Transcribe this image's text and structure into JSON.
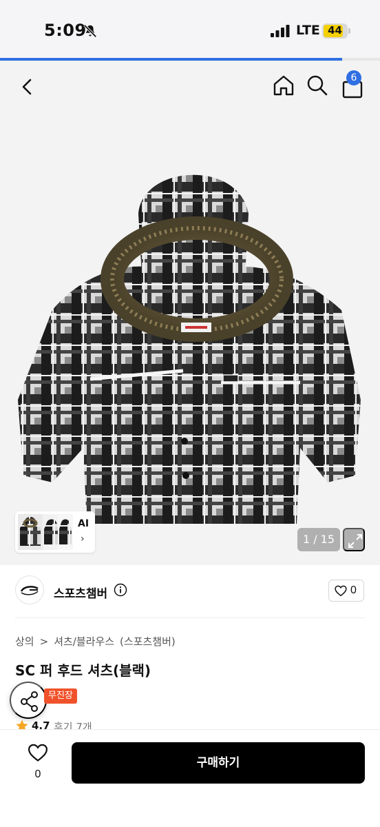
{
  "status_bar": {
    "time": "5:09",
    "network": "LTE",
    "battery": "44"
  },
  "loading_progress": 0.9,
  "header": {
    "cart_count": "6"
  },
  "gallery": {
    "thumb_label": "AI",
    "thumb_chevron": "›",
    "counter": "1 / 15"
  },
  "brand": {
    "name": "스포츠챔버",
    "like_count": "0"
  },
  "product": {
    "breadcrumb": [
      "상의",
      ">",
      "셔츠/블라우스",
      "(스포츠챔버)"
    ],
    "title": "SC 퍼 후드 셔츠(블랙)",
    "store_badge": "무진장",
    "rating": "4.7",
    "reviews": "후기 7개"
  },
  "bottom_bar": {
    "like_count": "0",
    "buy_label": "구매하기"
  },
  "icons": [
    "back-icon",
    "home-icon",
    "search-icon",
    "cart-icon",
    "expand-icon",
    "info-icon",
    "heart-icon",
    "share-icon",
    "star-icon"
  ],
  "colors": {
    "accent": "#2f6fe3",
    "badge": "#f0522b",
    "star": "#f5a623",
    "buy_button": "#000000"
  }
}
